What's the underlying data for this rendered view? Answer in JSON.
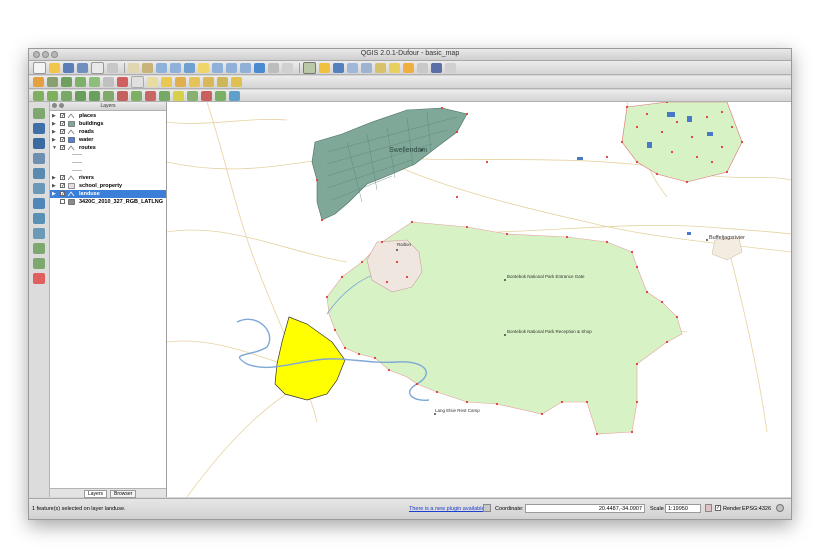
{
  "window": {
    "title": "QGIS 2.0.1-Dufour - basic_map"
  },
  "layers_panel": {
    "title": "Layers",
    "items": [
      {
        "name": "places",
        "checked": true,
        "expanded": false,
        "selected": false
      },
      {
        "name": "buildings",
        "checked": true,
        "expanded": false,
        "selected": false
      },
      {
        "name": "roads",
        "checked": true,
        "expanded": false,
        "selected": false
      },
      {
        "name": "water",
        "checked": true,
        "expanded": false,
        "selected": false
      },
      {
        "name": "routes",
        "checked": true,
        "expanded": true,
        "selected": false
      },
      {
        "name": "rivers",
        "checked": true,
        "expanded": false,
        "selected": false
      },
      {
        "name": "school_property",
        "checked": true,
        "expanded": false,
        "selected": false
      },
      {
        "name": "landuse",
        "checked": true,
        "expanded": false,
        "selected": true
      },
      {
        "name": "3420C_2010_327_RGB_LATLNG",
        "checked": false,
        "expanded": false,
        "selected": false
      }
    ],
    "tabs": [
      "Layers",
      "Browser"
    ]
  },
  "map": {
    "labels": {
      "town1": "Swellendam",
      "town2": "Railton",
      "gate": "Bontebok National Park Entrance Gate",
      "reception": "Bontebok National Park Reception & Shop",
      "camp": "Lang Elsie Rest Camp",
      "suurbraak": "Buffeljagsrivier"
    },
    "colors": {
      "park": "#d7f2c4",
      "town": "#7fa898",
      "selected": "#ffff00",
      "river": "#7fa8d6",
      "roads": "#e6d2a0",
      "points": "#e23a3a"
    }
  },
  "statusbar": {
    "message": "1 feature(s) selected on layer landuse.",
    "plugin_link": "There is a new plugin available",
    "coordinate_label": "Coordinate:",
    "coordinate_value": "20.4487,-34.0907",
    "scale_label": "Scale",
    "scale_value": "1:19950",
    "render_label": "Render",
    "crs": "EPSG:4326"
  }
}
